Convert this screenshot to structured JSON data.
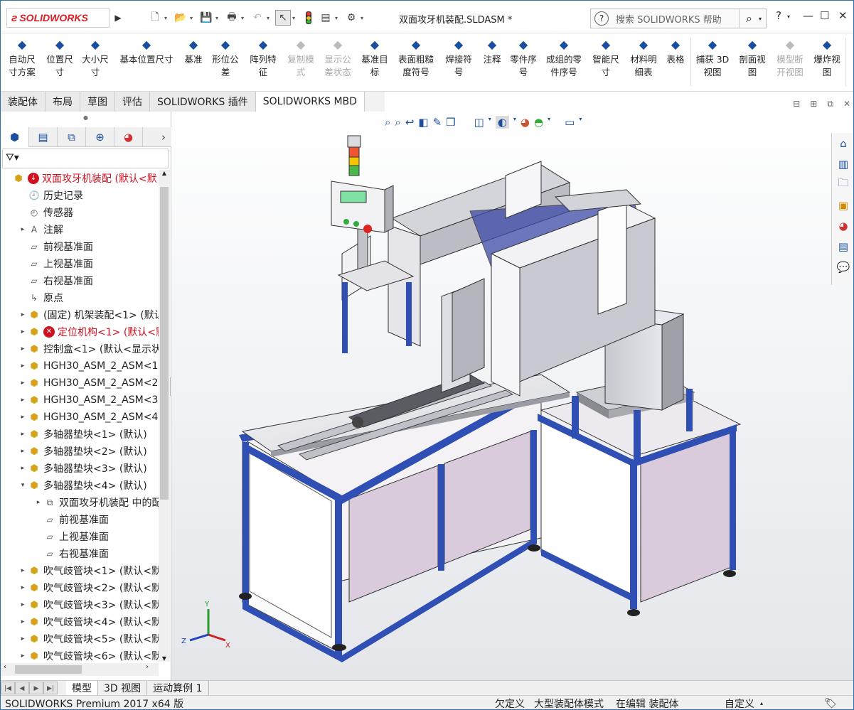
{
  "app": {
    "brand": "SOLIDWORKS",
    "window_title": "双面攻牙机装配.SLDASM *"
  },
  "search": {
    "placeholder": "搜索 SOLIDWORKS 帮助"
  },
  "commands": [
    {
      "label1": "自动尺",
      "label2": "寸方案",
      "icon": "auto-dimension-icon"
    },
    {
      "label1": "位置尺",
      "label2": "寸",
      "icon": "location-dimension-icon"
    },
    {
      "label1": "大小尺",
      "label2": "寸",
      "icon": "size-dimension-icon"
    },
    {
      "label1": "基本位置尺寸",
      "label2": "",
      "icon": "basic-location-dimension-icon"
    },
    {
      "label1": "基准",
      "label2": "",
      "icon": "datum-icon"
    },
    {
      "label1": "形位公",
      "label2": "差",
      "icon": "geometric-tolerance-icon"
    },
    {
      "label1": "阵列特",
      "label2": "征",
      "icon": "pattern-feature-icon"
    },
    {
      "label1": "复制模",
      "label2": "式",
      "icon": "copy-scheme-icon",
      "disabled": true
    },
    {
      "label1": "显示公",
      "label2": "差状态",
      "icon": "show-tolerance-status-icon",
      "disabled": true
    },
    {
      "label1": "基准目",
      "label2": "标",
      "icon": "datum-target-icon"
    },
    {
      "label1": "表面粗糙",
      "label2": "度符号",
      "icon": "surface-finish-icon"
    },
    {
      "label1": "焊接符",
      "label2": "号",
      "icon": "weld-symbol-icon"
    },
    {
      "label1": "注释",
      "label2": "",
      "icon": "note-icon"
    },
    {
      "label1": "零件序",
      "label2": "号",
      "icon": "balloon-icon"
    },
    {
      "label1": "成组的零",
      "label2": "件序号",
      "icon": "stacked-balloon-icon"
    },
    {
      "label1": "智能尺",
      "label2": "寸",
      "icon": "smart-dimension-icon"
    },
    {
      "label1": "材料明",
      "label2": "细表",
      "icon": "bom-icon"
    },
    {
      "label1": "表格",
      "label2": "",
      "icon": "table-icon"
    },
    {
      "label1": "捕获 3D",
      "label2": "视图",
      "icon": "capture-3d-view-icon"
    },
    {
      "label1": "剖面视",
      "label2": "图",
      "icon": "section-view-icon"
    },
    {
      "label1": "模型断",
      "label2": "开视图",
      "icon": "model-break-view-icon",
      "disabled": true
    },
    {
      "label1": "爆炸视",
      "label2": "图",
      "icon": "exploded-view-icon"
    }
  ],
  "tabs": [
    "装配体",
    "布局",
    "草图",
    "评估",
    "SOLIDWORKS 插件",
    "SOLIDWORKS MBD"
  ],
  "tree": [
    {
      "text": "双面攻牙机装配 (默认<默",
      "icon": "assembly",
      "err": true,
      "arrow": "",
      "level": 0
    },
    {
      "text": "历史记录",
      "icon": "history",
      "level": 1
    },
    {
      "text": "传感器",
      "icon": "sensor",
      "level": 1
    },
    {
      "text": "注解",
      "icon": "annotation",
      "arrow": "▸",
      "level": 1
    },
    {
      "text": "前视基准面",
      "icon": "plane",
      "level": 1
    },
    {
      "text": "上视基准面",
      "icon": "plane",
      "level": 1
    },
    {
      "text": "右视基准面",
      "icon": "plane",
      "level": 1
    },
    {
      "text": "原点",
      "icon": "origin",
      "level": 1
    },
    {
      "text": "(固定) 机架装配<1> (默认",
      "icon": "part",
      "arrow": "▸",
      "level": 1
    },
    {
      "text": "定位机构<1> (默认<默",
      "icon": "part",
      "arrow": "▸",
      "err": true,
      "level": 1
    },
    {
      "text": "控制盒<1> (默认<显示状",
      "icon": "part",
      "arrow": "▸",
      "level": 1
    },
    {
      "text": "HGH30_ASM_2_ASM<1",
      "icon": "part",
      "arrow": "▸",
      "level": 1
    },
    {
      "text": "HGH30_ASM_2_ASM<2",
      "icon": "part",
      "arrow": "▸",
      "level": 1
    },
    {
      "text": "HGH30_ASM_2_ASM<3",
      "icon": "part",
      "arrow": "▸",
      "level": 1
    },
    {
      "text": "HGH30_ASM_2_ASM<4",
      "icon": "part",
      "arrow": "▸",
      "level": 1
    },
    {
      "text": "多轴器垫块<1> (默认)",
      "icon": "part",
      "arrow": "▸",
      "level": 1
    },
    {
      "text": "多轴器垫块<2> (默认)",
      "icon": "part",
      "arrow": "▸",
      "level": 1
    },
    {
      "text": "多轴器垫块<3> (默认)",
      "icon": "part",
      "arrow": "▸",
      "level": 1
    },
    {
      "text": "多轴器垫块<4> (默认)",
      "icon": "part",
      "arrow": "▾",
      "level": 1
    },
    {
      "text": "双面攻牙机装配 中的配",
      "icon": "mate",
      "arrow": "▸",
      "level": 2
    },
    {
      "text": "前视基准面",
      "icon": "plane",
      "level": 2
    },
    {
      "text": "上视基准面",
      "icon": "plane",
      "level": 2
    },
    {
      "text": "右视基准面",
      "icon": "plane",
      "level": 2
    },
    {
      "text": "吹气歧管块<1> (默认<默",
      "icon": "part",
      "arrow": "▸",
      "level": 1
    },
    {
      "text": "吹气歧管块<2> (默认<默",
      "icon": "part",
      "arrow": "▸",
      "level": 1
    },
    {
      "text": "吹气歧管块<3> (默认<默",
      "icon": "part",
      "arrow": "▸",
      "level": 1
    },
    {
      "text": "吹气歧管块<4> (默认<默",
      "icon": "part",
      "arrow": "▸",
      "level": 1
    },
    {
      "text": "吹气歧管块<5> (默认<默",
      "icon": "part",
      "arrow": "▸",
      "level": 1
    },
    {
      "text": "吹气歧管块<6> (默认<默",
      "icon": "part",
      "arrow": "▸",
      "level": 1
    }
  ],
  "bottom_tabs": [
    "模型",
    "3D 视图",
    "运动算例 1"
  ],
  "status": {
    "product": "SOLIDWORKS Premium 2017 x64 版",
    "s1": "欠定义",
    "s2": "大型装配体模式",
    "s3": "在编辑 装配体",
    "s4": "自定义"
  },
  "colors": {
    "accent": "#1a4fa0",
    "error": "#d0101f",
    "frame": "#2f4fb5",
    "panel": "#d9cbdc"
  },
  "triad": {
    "x": "X",
    "y": "Y",
    "z": "Z"
  }
}
